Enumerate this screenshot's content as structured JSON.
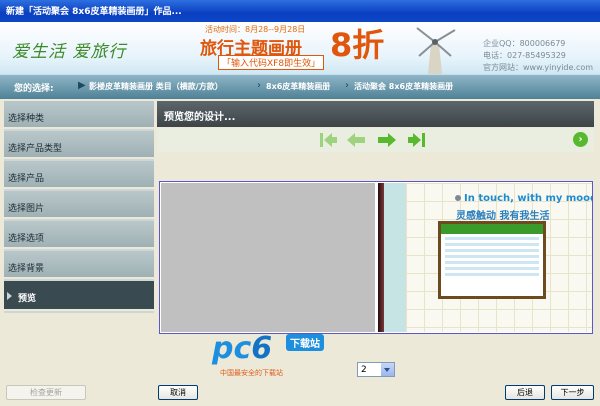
{
  "window": {
    "title": "新建「活动聚会 8x6皮革精装画册」作品..."
  },
  "banner": {
    "tagline": "爱生活 爱旅行",
    "promo_date": "活动时间：8月28--9月28日",
    "promo_title": "旅行主题画册",
    "promo_discount": "8折",
    "promo_code": "「输入代码XF8即生效」",
    "contact_qq": "企业QQ：800006679",
    "contact_phone": "电话：027-85495329",
    "contact_site": "官方网站：www.yinyide.com"
  },
  "breadcrumb": {
    "prefix": "您的选择:",
    "items": [
      "影楼皮革精装画册 类目（横款/方款）",
      "8x6皮革精装画册",
      "活动聚会 8x6皮革精装画册"
    ]
  },
  "sidebar": {
    "items": [
      {
        "label": "选择种类"
      },
      {
        "label": "选择产品类型"
      },
      {
        "label": "选择产品"
      },
      {
        "label": "选择图片"
      },
      {
        "label": "选择选项"
      },
      {
        "label": "选择背景"
      },
      {
        "label": "预览",
        "active": true
      }
    ]
  },
  "preview": {
    "header": "预览您的设计...",
    "page_heading_en": "In touch, with my moods",
    "page_heading_cn": "灵感触动  我有我生活",
    "page_select": {
      "value": "2"
    }
  },
  "watermark": {
    "logo_pc": "pc",
    "logo_six": "6",
    "badge": "下载站",
    "subtitle": "中国最安全的下载站"
  },
  "buttons": {
    "check_update": "检查更新",
    "cancel": "取消",
    "back": "后退",
    "next": "下一步"
  },
  "colors": {
    "nav_arrow": "#58b82e",
    "accent": "#e0560b"
  }
}
